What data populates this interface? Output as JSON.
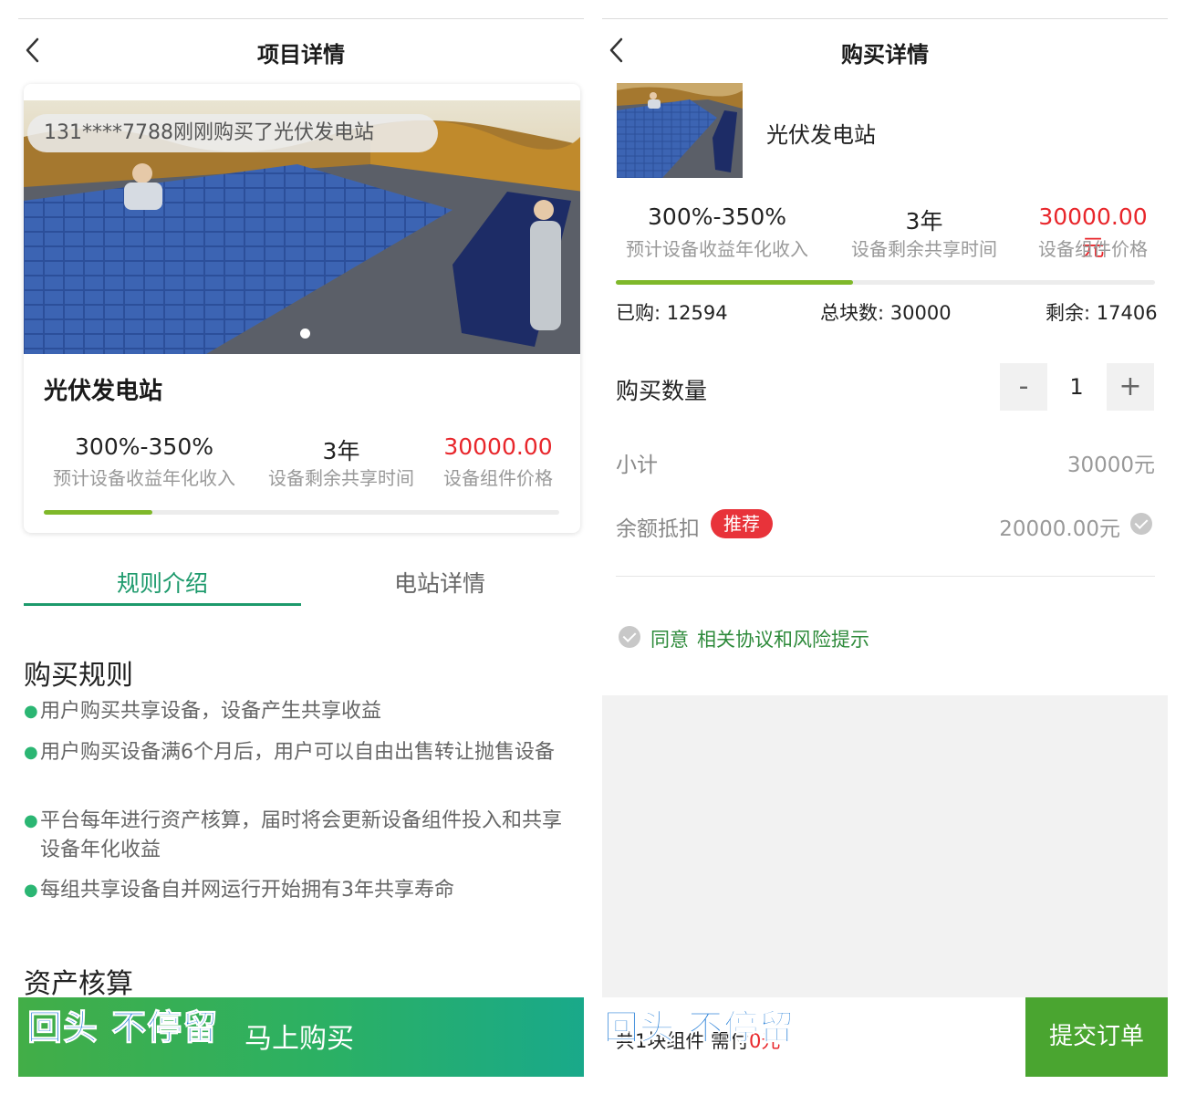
{
  "left": {
    "header": {
      "title": "项目详情"
    },
    "notice": "131****7788刚刚购买了光伏发电站",
    "card": {
      "title": "光伏发电站",
      "stats": [
        {
          "value": "300%-350%",
          "label": "预计设备收益年化收入"
        },
        {
          "value": "3年",
          "label": "设备剩余共享时间"
        },
        {
          "value": "30000.00",
          "label": "设备组件价格"
        }
      ],
      "progress_fraction": 0.21
    },
    "tabs": [
      {
        "label": "规则介绍",
        "active": true
      },
      {
        "label": "电站详情",
        "active": false
      }
    ],
    "rules": {
      "heading": "购买规则",
      "items": [
        "用户购买共享设备，设备产生共享收益",
        "用户购买设备满6个月后，用户可以自由出售转让抛售设备",
        "平台每年进行资产核算，届时将会更新设备组件投入和共享设备年化收益",
        "每组共享设备自并网运行开始拥有3年共享寿命"
      ]
    },
    "section2_heading": "资产核算",
    "buy_bar": {
      "slogan": "回头 不停留",
      "label": "马上购买"
    }
  },
  "right": {
    "header": {
      "title": "购买详情"
    },
    "product_name": "光伏发电站",
    "stats": [
      {
        "value": "300%-350%",
        "label": "预计设备收益年化收入"
      },
      {
        "value": "3年",
        "label": "设备剩余共享时间"
      },
      {
        "value": "30000.00元",
        "label": "设备组件价格"
      }
    ],
    "progress_fraction": 0.44,
    "counts": {
      "bought": "已购: 12594",
      "total": "总块数: 30000",
      "remaining": "剩余: 17406"
    },
    "quantity": {
      "label": "购买数量",
      "minus": "-",
      "value": "1",
      "plus": "+"
    },
    "subtotal": {
      "label": "小计",
      "value": "30000元"
    },
    "balance": {
      "label": "余额抵扣",
      "badge": "推荐",
      "value": "20000.00元"
    },
    "agreement": {
      "agree": "同意",
      "link": "相关协议和风险提示"
    },
    "footer": {
      "slogan": "回头 不停留",
      "summary_prefix": "共1块组件 需付",
      "summary_amount": "0元",
      "submit": "提交订单"
    }
  },
  "colors": {
    "accent_green": "#2bb064",
    "price_red": "#e8262b",
    "tab_green": "#1d9a6c"
  }
}
